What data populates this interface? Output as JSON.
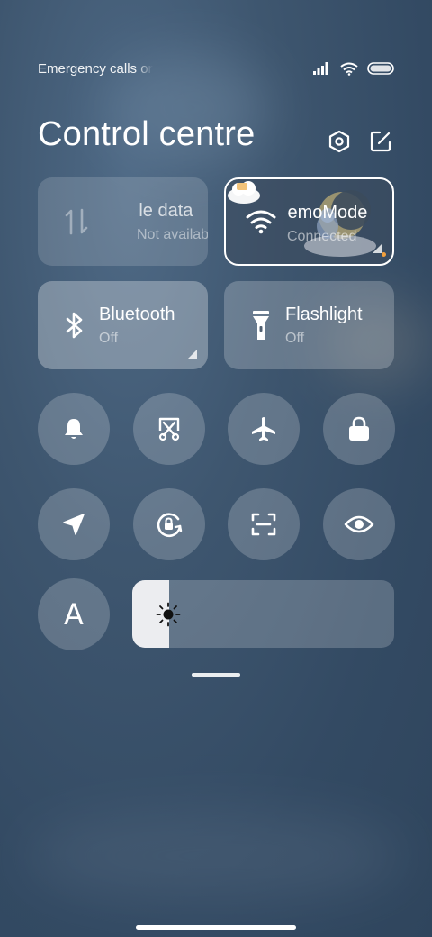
{
  "status": {
    "left_text": "Emergency calls only"
  },
  "header": {
    "title": "Control centre",
    "settings_icon": "hexagon-settings-icon",
    "edit_icon": "edit-icon"
  },
  "tiles": {
    "mobile_data": {
      "title": "Mobile data",
      "status": "Not available",
      "icon": "mobile-data-icon"
    },
    "wifi": {
      "title": "DemoMode",
      "status": "Connected",
      "icon": "wifi-icon"
    },
    "bluetooth": {
      "title": "Bluetooth",
      "status": "Off",
      "icon": "bluetooth-icon"
    },
    "flashlight": {
      "title": "Flashlight",
      "status": "Off",
      "icon": "flashlight-icon"
    }
  },
  "round_buttons": [
    {
      "name": "sound",
      "icon": "bell-icon"
    },
    {
      "name": "screenshot",
      "icon": "screenshot-icon"
    },
    {
      "name": "airplane-mode",
      "icon": "airplane-icon"
    },
    {
      "name": "lock-screen",
      "icon": "lock-icon"
    },
    {
      "name": "location",
      "icon": "location-arrow-icon"
    },
    {
      "name": "rotation-lock",
      "icon": "rotation-lock-icon"
    },
    {
      "name": "scanner",
      "icon": "scan-icon"
    },
    {
      "name": "reading-mode",
      "icon": "eye-icon"
    },
    {
      "name": "auto-brightness",
      "icon": "letter-a-icon",
      "label": "A"
    }
  ],
  "brightness": {
    "level": 0.14,
    "icon": "sun-icon"
  },
  "colors": {
    "accent_active": "#ffffff",
    "brightness_fill": "#ecedf0",
    "background": "#3e566f"
  }
}
